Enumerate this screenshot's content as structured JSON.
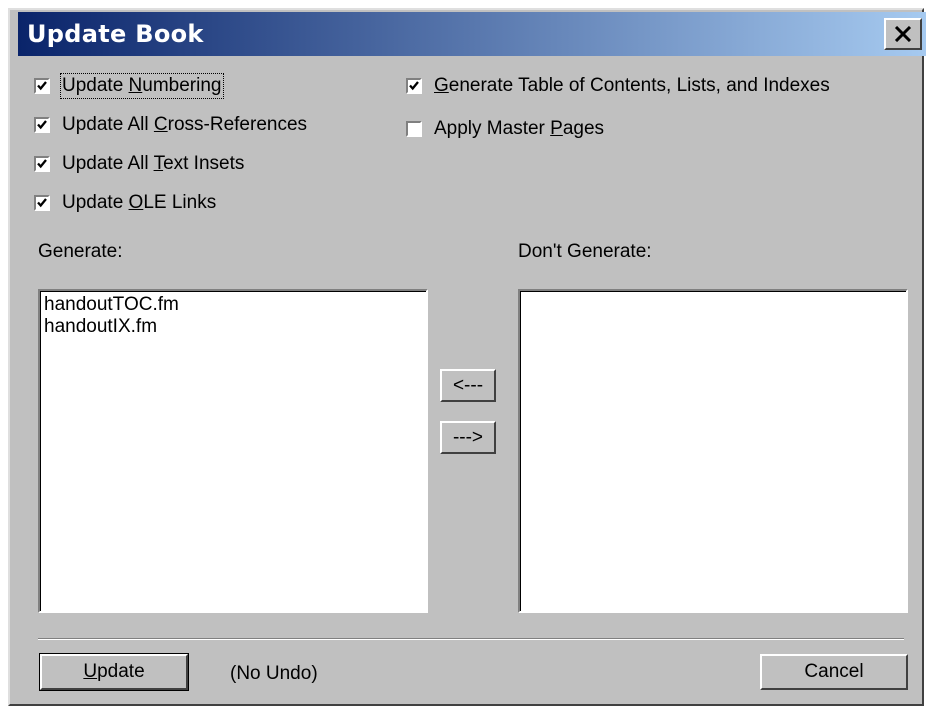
{
  "window": {
    "title": "Update Book"
  },
  "options": {
    "update_numbering": {
      "pre": "Update ",
      "key": "N",
      "post": "umbering",
      "checked": true
    },
    "update_xrefs": {
      "pre": "Update All ",
      "key": "C",
      "post": "ross-References",
      "checked": true
    },
    "update_text_insets": {
      "pre": "Update All ",
      "key": "T",
      "post": "ext Insets",
      "checked": true
    },
    "update_ole": {
      "pre": "Update ",
      "key": "O",
      "post": "LE Links",
      "checked": true
    },
    "generate_toc": {
      "pre": "",
      "key": "G",
      "post": "enerate Table of Contents, Lists, and Indexes",
      "checked": true
    },
    "apply_master": {
      "pre": "Apply Master ",
      "key": "P",
      "post": "ages",
      "checked": false
    }
  },
  "generate": {
    "label": "Generate:",
    "items": [
      "handoutTOC.fm",
      "handoutIX.fm"
    ]
  },
  "dont_generate": {
    "label": "Don't Generate:",
    "items": []
  },
  "move": {
    "left_label": "<---",
    "right_label": "--->"
  },
  "footer": {
    "update": {
      "key": "U",
      "post": "pdate"
    },
    "no_undo": "(No Undo)",
    "cancel_label": "Cancel"
  }
}
